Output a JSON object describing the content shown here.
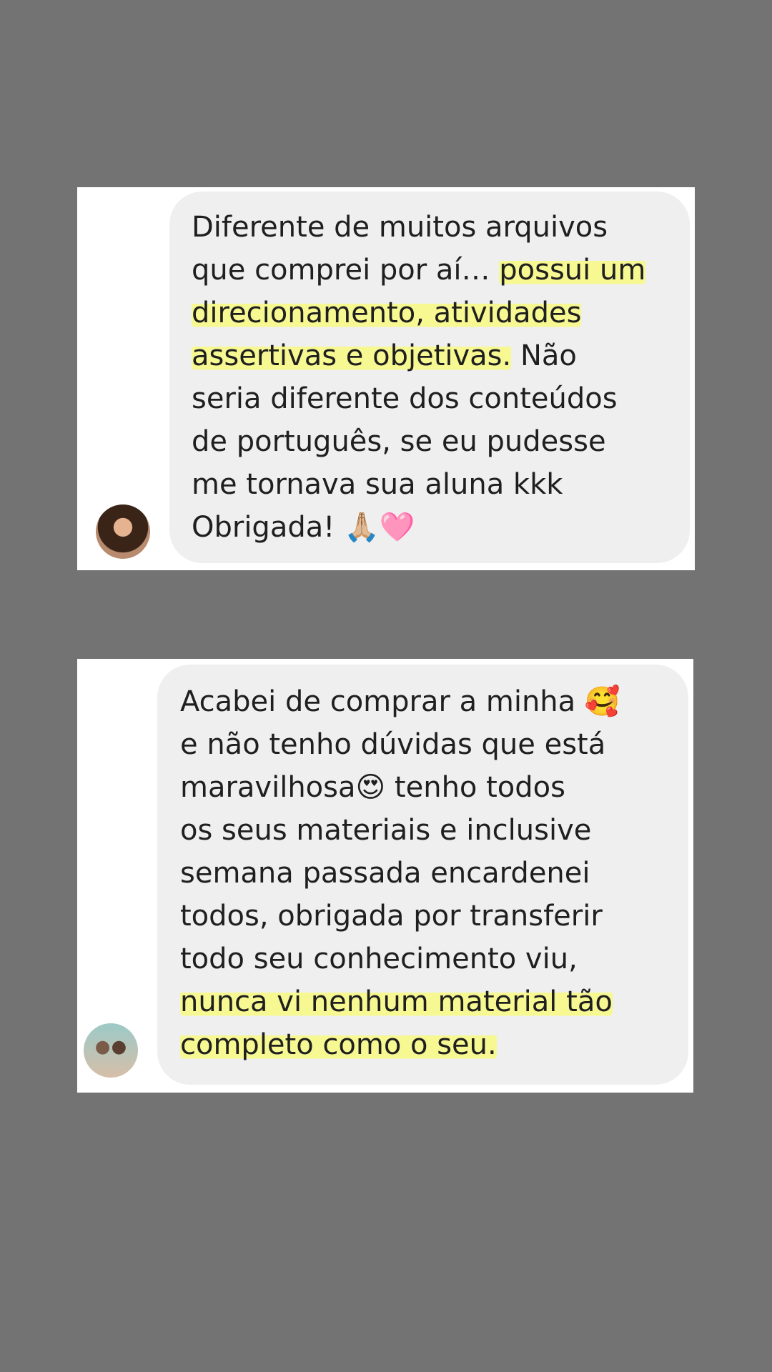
{
  "messages": [
    {
      "lines": [
        {
          "parts": [
            {
              "text": "Diferente de muitos arquivos",
              "hl": false
            }
          ]
        },
        {
          "parts": [
            {
              "text": "que comprei por aí… ",
              "hl": false
            },
            {
              "text": "possui um",
              "hl": true
            }
          ]
        },
        {
          "parts": [
            {
              "text": "direcionamento, atividades",
              "hl": true
            }
          ]
        },
        {
          "parts": [
            {
              "text": "assertivas e objetivas.",
              "hl": true
            },
            {
              "text": " Não",
              "hl": false
            }
          ]
        },
        {
          "parts": [
            {
              "text": "seria diferente dos conteúdos",
              "hl": false
            }
          ]
        },
        {
          "parts": [
            {
              "text": "de português, se eu pudesse",
              "hl": false
            }
          ]
        },
        {
          "parts": [
            {
              "text": "me tornava sua aluna kkk",
              "hl": false
            }
          ]
        },
        {
          "parts": [
            {
              "text": "Obrigada! 🙏🏼🩷",
              "hl": false
            }
          ]
        }
      ]
    },
    {
      "lines": [
        {
          "parts": [
            {
              "text": "Acabei de comprar a minha 🥰",
              "hl": false
            }
          ]
        },
        {
          "parts": [
            {
              "text": "e não tenho dúvidas que está",
              "hl": false
            }
          ]
        },
        {
          "parts": [
            {
              "text": "maravilhosa😍 tenho todos",
              "hl": false
            }
          ]
        },
        {
          "parts": [
            {
              "text": "os seus materiais e inclusive",
              "hl": false
            }
          ]
        },
        {
          "parts": [
            {
              "text": "semana passada encardenei",
              "hl": false
            }
          ]
        },
        {
          "parts": [
            {
              "text": "todos, obrigada por transferir",
              "hl": false
            }
          ]
        },
        {
          "parts": [
            {
              "text": "todo seu conhecimento viu,",
              "hl": false
            }
          ]
        },
        {
          "parts": [
            {
              "text": "nunca vi nenhum material tão",
              "hl": true
            }
          ]
        },
        {
          "parts": [
            {
              "text": "completo como o seu.",
              "hl": true
            }
          ]
        }
      ]
    }
  ]
}
